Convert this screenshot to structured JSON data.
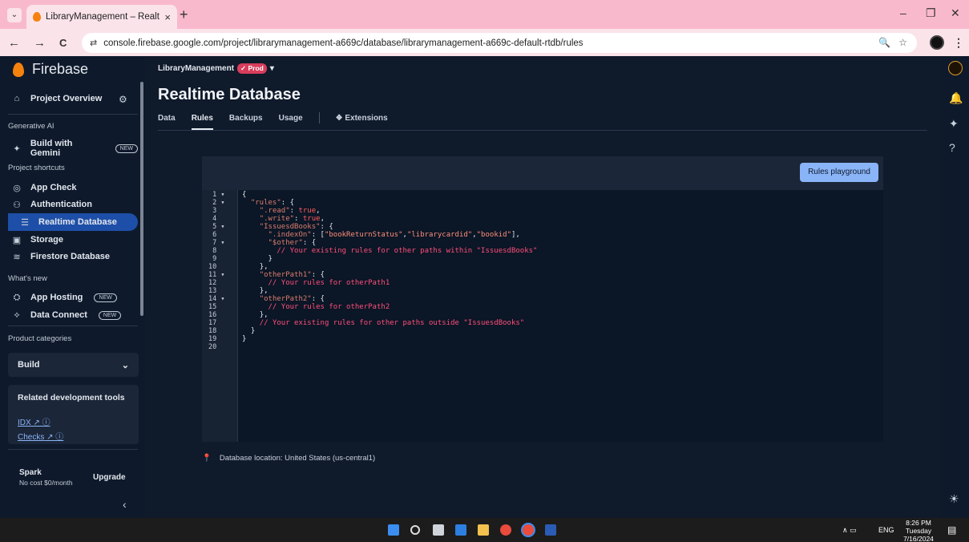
{
  "browser": {
    "tab_title": "LibraryManagement – Realtime",
    "tab_close": "×",
    "new_tab": "+",
    "url": "console.firebase.google.com/project/librarymanagement-a669c/database/librarymanagement-a669c-default-rtdb/rules",
    "menu_glyph": "⌄",
    "minimize": "–",
    "restore": "❐",
    "close": "✕",
    "back": "←",
    "forward": "→",
    "reload": "C",
    "site_info": "⇄",
    "zoom_icon": "🔍",
    "star_icon": "☆",
    "kebab": "⋮"
  },
  "sidebar": {
    "brand": "Firebase",
    "project_overview": "Project Overview",
    "sections": {
      "generative_ai": "Generative AI",
      "project_shortcuts": "Project shortcuts",
      "whats_new": "What's new",
      "product_categories": "Product categories"
    },
    "new_badge": "NEW",
    "items": {
      "build_with_gemini": "Build with Gemini",
      "app_check": "App Check",
      "authentication": "Authentication",
      "realtime_database": "Realtime Database",
      "storage": "Storage",
      "firestore_database": "Firestore Database",
      "app_hosting": "App Hosting",
      "data_connect": "Data Connect"
    },
    "build": "Build",
    "related_tools": "Related development tools",
    "idx": "IDX",
    "checks": "Checks",
    "plan": "Spark",
    "plan_cost": "No cost $0/month",
    "upgrade": "Upgrade",
    "collapse": "‹"
  },
  "main": {
    "project_name": "LibraryManagement",
    "env_badge": "Prod",
    "page_title": "Realtime Database",
    "tabs": [
      "Data",
      "Rules",
      "Backups",
      "Usage"
    ],
    "extensions_tab": "Extensions",
    "rules_playground": "Rules playground",
    "location": "Database location: United States (us-central1)"
  },
  "code_lines": [
    {
      "n": "1",
      "fold": true
    },
    {
      "n": "2",
      "fold": true
    },
    {
      "n": "3"
    },
    {
      "n": "4"
    },
    {
      "n": "5",
      "fold": true
    },
    {
      "n": "6"
    },
    {
      "n": "7",
      "fold": true
    },
    {
      "n": "8"
    },
    {
      "n": "9"
    },
    {
      "n": "10"
    },
    {
      "n": "11",
      "fold": true
    },
    {
      "n": "12"
    },
    {
      "n": "13"
    },
    {
      "n": "14",
      "fold": true
    },
    {
      "n": "15"
    },
    {
      "n": "16"
    },
    {
      "n": "17"
    },
    {
      "n": "18"
    },
    {
      "n": "19"
    },
    {
      "n": "20"
    }
  ],
  "code": {
    "l1": "{",
    "l2_key": "\"rules\"",
    "l2_rest": ": {",
    "l3_key": "\".read\"",
    "l3_val": "true",
    "l4_key": "\".write\"",
    "l4_val": "true",
    "l5_key": "\"IssuesdBooks\"",
    "l5_rest": ": {",
    "l6_key": "\".indexOn\"",
    "l6_v1": "\"bookReturnStatus\"",
    "l6_v2": "\"librarycardid\"",
    "l6_v3": "\"bookid\"",
    "l7_key": "\"$other\"",
    "l7_rest": ": {",
    "l8": "// Your existing rules for other paths within \"IssuesdBooks\"",
    "l9": "}",
    "l10": "},",
    "l11_key": "\"otherPath1\"",
    "l11_rest": ": {",
    "l12": "// Your rules for otherPath1",
    "l13": "},",
    "l14_key": "\"otherPath2\"",
    "l14_rest": ": {",
    "l15": "// Your rules for otherPath2",
    "l16": "},",
    "l17": "// Your existing rules for other paths outside \"IssuesdBooks\"",
    "l18": "}",
    "l19": "}"
  },
  "taskbar": {
    "lang": "ENG",
    "time": "8:26 PM",
    "day": "Tuesday",
    "date": "7/16/2024"
  }
}
